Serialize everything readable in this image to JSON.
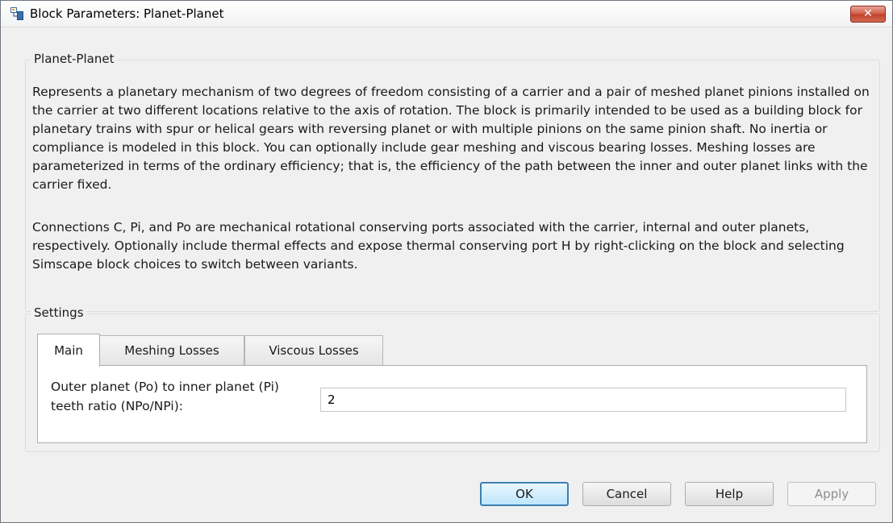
{
  "window": {
    "title": "Block Parameters: Planet-Planet",
    "icon": "simulink-block-icon",
    "close_label": "✕"
  },
  "description_group": {
    "label": "Planet-Planet",
    "paragraph1": "Represents a planetary mechanism of two degrees of freedom consisting of a carrier and a pair of meshed planet pinions installed on the carrier at two different locations relative to the axis of rotation. The block is primarily intended to be used as a building block for planetary trains with spur or helical gears with reversing planet or with multiple pinions on the same pinion shaft. No inertia or compliance is modeled in this block. You can optionally include gear meshing and viscous bearing losses. Meshing losses are parameterized in terms of the ordinary efficiency; that is,  the efficiency of the path between the inner and outer planet links with the carrier fixed.",
    "paragraph2": "Connections C, Pi, and Po are mechanical rotational conserving ports associated with the carrier, internal and outer planets, respectively. Optionally include thermal effects and expose thermal conserving port H by right-clicking on the block and selecting Simscape block choices to switch between variants."
  },
  "settings_group": {
    "label": "Settings",
    "tabs": [
      {
        "label": "Main",
        "active": true
      },
      {
        "label": "Meshing Losses",
        "active": false
      },
      {
        "label": "Viscous Losses",
        "active": false
      }
    ],
    "main": {
      "param_label": "Outer planet (Po) to inner planet (Pi) teeth ratio (NPo/NPi):",
      "param_value": "2"
    }
  },
  "buttons": {
    "ok": "OK",
    "cancel": "Cancel",
    "help": "Help",
    "apply": "Apply"
  },
  "colors": {
    "close_button": "#c7422c",
    "default_button_border": "#3c7fb1",
    "window_bg": "#f0f0f0"
  }
}
